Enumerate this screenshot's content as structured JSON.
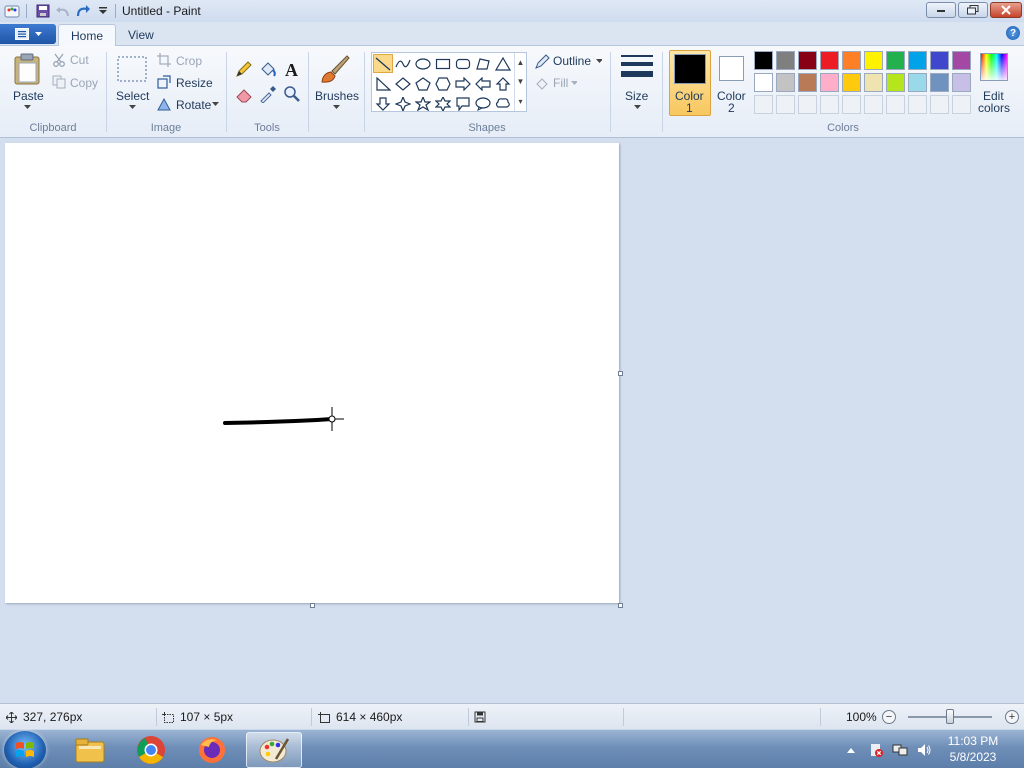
{
  "window": {
    "title": "Untitled - Paint"
  },
  "tabs": [
    {
      "label": "Home"
    },
    {
      "label": "View"
    }
  ],
  "clipboard": {
    "paste": "Paste",
    "cut": "Cut",
    "copy": "Copy",
    "group": "Clipboard"
  },
  "image": {
    "select": "Select",
    "crop": "Crop",
    "resize": "Resize",
    "rotate": "Rotate",
    "group": "Image"
  },
  "tools": {
    "group": "Tools"
  },
  "brushes": {
    "label": "Brushes"
  },
  "shapes": {
    "outline": "Outline",
    "fill": "Fill",
    "group": "Shapes"
  },
  "size": {
    "label": "Size"
  },
  "colors": {
    "color1_label": "Color",
    "color1_num": "1",
    "color2_label": "Color",
    "color2_num": "2",
    "edit_label": "Edit",
    "edit_label2": "colors",
    "group": "Colors",
    "color1": "#000000",
    "color2": "#ffffff",
    "palette_row1": [
      "#000000",
      "#7f7f7f",
      "#880015",
      "#ed1c24",
      "#ff7f27",
      "#fff200",
      "#22b14c",
      "#00a2e8",
      "#3f48cc",
      "#a349a4"
    ],
    "palette_row2": [
      "#ffffff",
      "#c3c3c3",
      "#b97a57",
      "#ffaec9",
      "#ffc90e",
      "#efe4b0",
      "#b5e61d",
      "#99d9ea",
      "#7092be",
      "#c8bfe7"
    ]
  },
  "status": {
    "cursor_pos": "327, 276px",
    "selection_size": "107 × 5px",
    "image_size": "614 × 460px",
    "zoom": "100%"
  },
  "taskbar": {
    "time": "11:03 PM",
    "date": "5/8/2023"
  }
}
